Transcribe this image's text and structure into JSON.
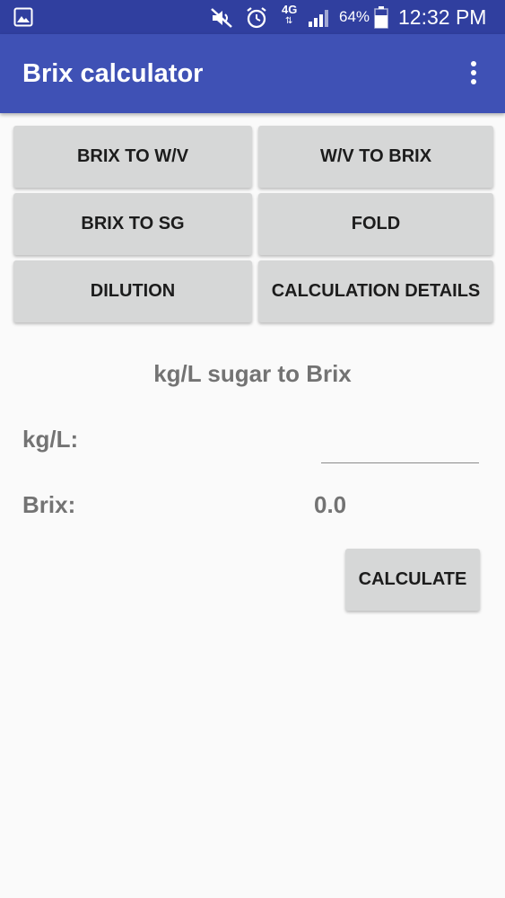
{
  "status_bar": {
    "network": "4G",
    "battery": "64%",
    "time": "12:32 PM",
    "icons": [
      "gallery-icon",
      "mute-icon",
      "alarm-icon",
      "network-arrows-icon",
      "signal-icon",
      "battery-icon"
    ]
  },
  "app_bar": {
    "title": "Brix calculator",
    "menu_icon": "overflow-menu-icon"
  },
  "mode_buttons": {
    "brix_to_wv": "BRIX TO W/V",
    "wv_to_brix": "W/V TO BRIX",
    "brix_to_sg": "BRIX TO SG",
    "fold": "FOLD",
    "dilution": "DILUTION",
    "calculation_details": "CALCULATION DETAILS"
  },
  "form": {
    "title": "kg/L sugar to Brix",
    "kgl_label": "kg/L:",
    "kgl_value": "",
    "brix_label": "Brix:",
    "brix_value": "0.0",
    "calculate_label": "CALCULATE"
  },
  "colors": {
    "status_bar": "#303f9f",
    "app_bar": "#3f51b5",
    "button_bg": "#d6d7d7",
    "label_text": "#737373"
  }
}
